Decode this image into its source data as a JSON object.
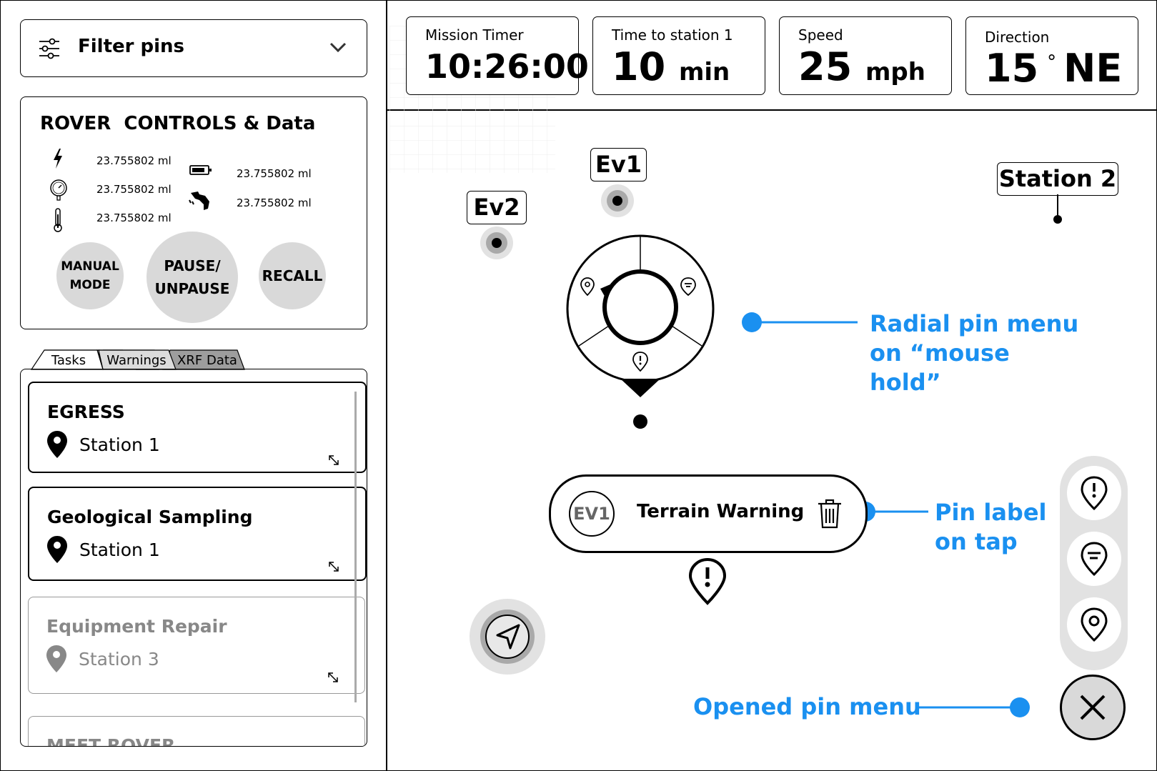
{
  "filter": {
    "label": "Filter pins"
  },
  "rover": {
    "title": "ROVER  CONTROLS & Data",
    "readings": [
      {
        "icon": "bolt-icon",
        "value": "23.755802 ml"
      },
      {
        "icon": "pressure-gauge-icon",
        "value": "23.755802 ml"
      },
      {
        "icon": "thermometer-icon",
        "value": "23.755802 ml"
      },
      {
        "icon": "battery-icon",
        "value": "23.755802 ml"
      },
      {
        "icon": "fuel-nozzle-icon",
        "value": "23.755802 ml"
      }
    ],
    "buttons": {
      "manual_line1": "MANUAL",
      "manual_line2": "MODE",
      "pause_line1": "PAUSE/",
      "pause_line2": "UNPAUSE",
      "recall": "RECALL"
    }
  },
  "tabs": [
    "Tasks",
    "Warnings",
    "XRF Data"
  ],
  "tasks": [
    {
      "title": "EGRESS",
      "station": "Station 1"
    },
    {
      "title": "Geological Sampling",
      "station": "Station 1"
    },
    {
      "title": "Equipment Repair",
      "station": "Station 3"
    },
    {
      "title": "MEET ROVER",
      "station": ""
    }
  ],
  "stats": {
    "timer": {
      "label": "Mission Timer",
      "value": "10:26:00"
    },
    "station_time": {
      "label": "Time to station 1",
      "value": "10",
      "unit": "min"
    },
    "speed": {
      "label": "Speed",
      "value": "25",
      "unit": "mph"
    },
    "direction": {
      "label": "Direction",
      "value": "15",
      "deg": "°",
      "unit": "NE"
    }
  },
  "map": {
    "pins": {
      "ev1": "Ev1",
      "ev2": "Ev2",
      "station2": "Station 2"
    },
    "terrain": {
      "badge": "EV1",
      "label": "Terrain Warning"
    }
  },
  "annotations": {
    "radial": [
      "Radial pin menu",
      "on “mouse",
      "hold”"
    ],
    "label": [
      "Pin label",
      "on tap"
    ],
    "opened": "Opened pin menu"
  },
  "colors": {
    "accent": "#1a90f0",
    "button_gray": "#d9d9d9"
  }
}
